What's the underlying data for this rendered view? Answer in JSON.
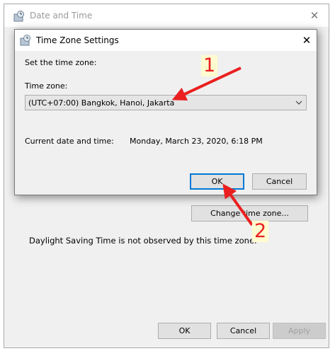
{
  "outer_window": {
    "title": "Date and Time",
    "change_tz_button": "Change time zone...",
    "dst_text": "Daylight Saving Time is not observed by this time zone.",
    "ok_label": "OK",
    "cancel_label": "Cancel",
    "apply_label": "Apply"
  },
  "dialog": {
    "title": "Time Zone Settings",
    "set_label": "Set the time zone:",
    "tz_label": "Time zone:",
    "tz_value": "(UTC+07:00) Bangkok, Hanoi, Jakarta",
    "current_label": "Current date and time:",
    "current_value": "Monday, March 23, 2020, 6:18 PM",
    "ok_label": "OK",
    "cancel_label": "Cancel"
  },
  "annotations": {
    "step1": "1",
    "step2": "2",
    "arrow_color": "#ea1f1f"
  },
  "icons": {
    "window_icon": "clock-globe-icon",
    "close": "close-icon",
    "dropdown": "chevron-down-icon"
  }
}
